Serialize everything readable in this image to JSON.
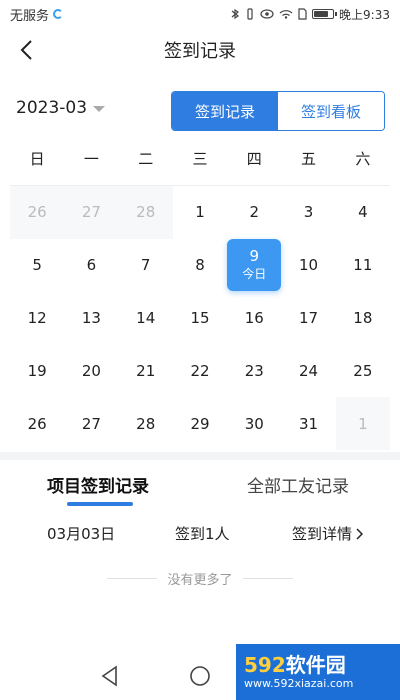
{
  "status_bar": {
    "carrier": "无服务",
    "time": "晚上9:33",
    "battery_level": 0.85
  },
  "nav": {
    "title": "签到记录"
  },
  "month_picker": {
    "value": "2023-03"
  },
  "segment": {
    "options": [
      "签到记录",
      "签到看板"
    ],
    "selected": "签到记录"
  },
  "calendar": {
    "weekdays": [
      "日",
      "一",
      "二",
      "三",
      "四",
      "五",
      "六"
    ],
    "today_label": "今日",
    "today": "9",
    "days": [
      {
        "d": "26",
        "other": true
      },
      {
        "d": "27",
        "other": true
      },
      {
        "d": "28",
        "other": true
      },
      {
        "d": "1"
      },
      {
        "d": "2"
      },
      {
        "d": "3"
      },
      {
        "d": "4"
      },
      {
        "d": "5"
      },
      {
        "d": "6"
      },
      {
        "d": "7"
      },
      {
        "d": "8"
      },
      {
        "d": "9",
        "today": true
      },
      {
        "d": "10"
      },
      {
        "d": "11"
      },
      {
        "d": "12"
      },
      {
        "d": "13"
      },
      {
        "d": "14"
      },
      {
        "d": "15"
      },
      {
        "d": "16"
      },
      {
        "d": "17"
      },
      {
        "d": "18"
      },
      {
        "d": "19"
      },
      {
        "d": "20"
      },
      {
        "d": "21"
      },
      {
        "d": "22"
      },
      {
        "d": "23"
      },
      {
        "d": "24"
      },
      {
        "d": "25"
      },
      {
        "d": "26"
      },
      {
        "d": "27"
      },
      {
        "d": "28"
      },
      {
        "d": "29"
      },
      {
        "d": "30"
      },
      {
        "d": "31"
      },
      {
        "d": "1",
        "other": true
      }
    ]
  },
  "tabs": {
    "project": "项目签到记录",
    "all": "全部工友记录",
    "selected": "项目签到记录"
  },
  "records": [
    {
      "date": "03月03日",
      "count": "签到1人",
      "detail": "签到详情"
    }
  ],
  "no_more": "没有更多了",
  "watermark": {
    "brand_num": "592",
    "brand_text": "软件园",
    "url": "www.592xiazai.com"
  },
  "colors": {
    "accent": "#2f7de1",
    "today": "#3d98f2"
  },
  "icons": {
    "back": "back-arrow-icon",
    "caret": "caret-down-icon",
    "chevron": "chevron-right-icon"
  }
}
